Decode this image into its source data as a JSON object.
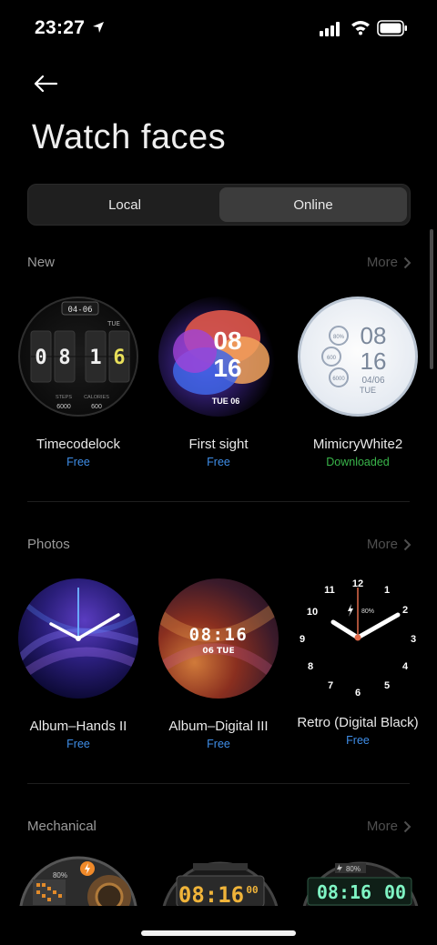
{
  "status_bar": {
    "time": "23:27"
  },
  "header": {
    "title": "Watch faces"
  },
  "tabs": [
    {
      "label": "Local"
    },
    {
      "label": "Online"
    }
  ],
  "sections": [
    {
      "title": "New",
      "more_label": "More",
      "items": [
        {
          "name": "Timecodelock",
          "status": "Free",
          "face": {
            "date": "04-06",
            "day": "TUE",
            "digits": [
              "0",
              "8",
              "1",
              "6"
            ],
            "footer": [
              "STEPS",
              "CALORIES"
            ],
            "values": [
              "6000",
              "600"
            ]
          }
        },
        {
          "name": "First sight",
          "status": "Free",
          "face": {
            "hour": "08",
            "minute": "16",
            "date": "TUE 06"
          }
        },
        {
          "name": "MimicryWhite2",
          "status": "Downloaded",
          "face": {
            "hour": "08",
            "minute": "16",
            "date": "04/06",
            "day": "TUE",
            "comp1": "80%",
            "comp2": "600",
            "comp3": "6000"
          }
        }
      ]
    },
    {
      "title": "Photos",
      "more_label": "More",
      "items": [
        {
          "name": "Album–Hands II",
          "status": "Free"
        },
        {
          "name": "Album–Digital III",
          "status": "Free",
          "face": {
            "time": "08:16",
            "date": "06 TUE"
          }
        },
        {
          "name": "Retro (Digital Black)",
          "status": "Free",
          "face": {
            "battery": "80%",
            "numbers": [
              "12",
              "1",
              "2",
              "3",
              "4",
              "5",
              "6",
              "7",
              "8",
              "9",
              "10",
              "11"
            ]
          }
        }
      ]
    },
    {
      "title": "Mechanical",
      "more_label": "More",
      "items": [
        {
          "face": {
            "battery": "80%"
          }
        },
        {
          "face": {
            "time": "08:16",
            "seconds": "00"
          }
        },
        {
          "face": {
            "battery": "80%",
            "time": "08:16",
            "seconds": "00"
          }
        }
      ]
    }
  ],
  "colors": {
    "accent_free": "#3f8ee8",
    "downloaded": "#39b54a",
    "segment_active": "#3c3c3c"
  }
}
